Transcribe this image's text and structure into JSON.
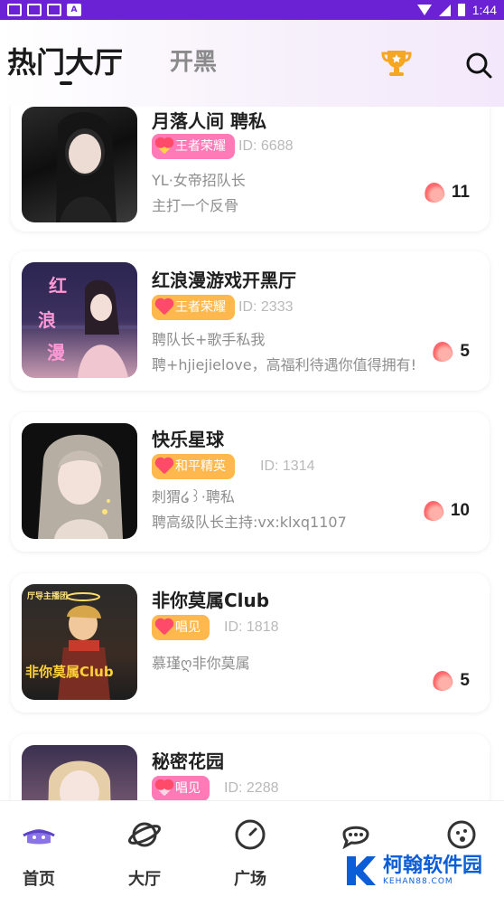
{
  "status_bar": {
    "time": "1:44",
    "app_icon_letter": "A"
  },
  "header": {
    "tabs": [
      {
        "label": "热门大厅",
        "active": true
      },
      {
        "label": "开黑",
        "active": false
      }
    ],
    "icons": [
      "trophy-icon",
      "search-icon"
    ]
  },
  "rooms": [
    {
      "name": "月落人间 聘私",
      "tag": "王者荣耀",
      "tag_color": "#ff7ab6",
      "room_id": "ID: 6688",
      "line1": "YL·女帝招队长",
      "line2": "主打一个反骨",
      "heat": "11"
    },
    {
      "name": "红浪漫游戏开黑厅",
      "tag": "王者荣耀",
      "tag_color": "#ffb84d",
      "room_id": "ID: 2333",
      "line1": "聘队长+歌手私我",
      "line2": "聘+hjiejielove，高福利待遇你值得拥有!",
      "heat": "5"
    },
    {
      "name": "快乐星球",
      "tag": "和平精英",
      "tag_color": "#ffb84d",
      "room_id": "ID: 1314",
      "line1": "刺猬໒꒱·聘私",
      "line2": "聘高级队长主持:vx:klxq1107",
      "heat": "10"
    },
    {
      "name": "非你莫属Club",
      "tag": "唱见",
      "tag_color": "#ffb84d",
      "room_id": "ID: 1818",
      "line1": "慕瑾ღ非你莫属",
      "line2": "",
      "heat": "5"
    },
    {
      "name": "秘密花园",
      "tag": "唱见",
      "tag_color": "#ff7ab6",
      "room_id": "ID: 2288",
      "line1": "",
      "line2": "",
      "heat": ""
    }
  ],
  "covers": {
    "room2_text": [
      "红",
      "浪",
      "漫"
    ],
    "room4_top": "厅导主播团",
    "room4_text": "非你莫属Club"
  },
  "bottom_nav": [
    {
      "label": "首页",
      "icon": "home-planet-icon"
    },
    {
      "label": "大厅",
      "icon": "planet-icon"
    },
    {
      "label": "广场",
      "icon": "compass-icon"
    },
    {
      "label": "",
      "icon": "chat-icon"
    },
    {
      "label": "",
      "icon": "face-icon"
    }
  ],
  "watermark": {
    "title": "柯翰软件园",
    "subtitle": "KEHAN88.COM"
  },
  "colors": {
    "status_bar": "#6a22d4",
    "accent_purple": "#7a4fd1",
    "trophy": "#f5a623"
  }
}
